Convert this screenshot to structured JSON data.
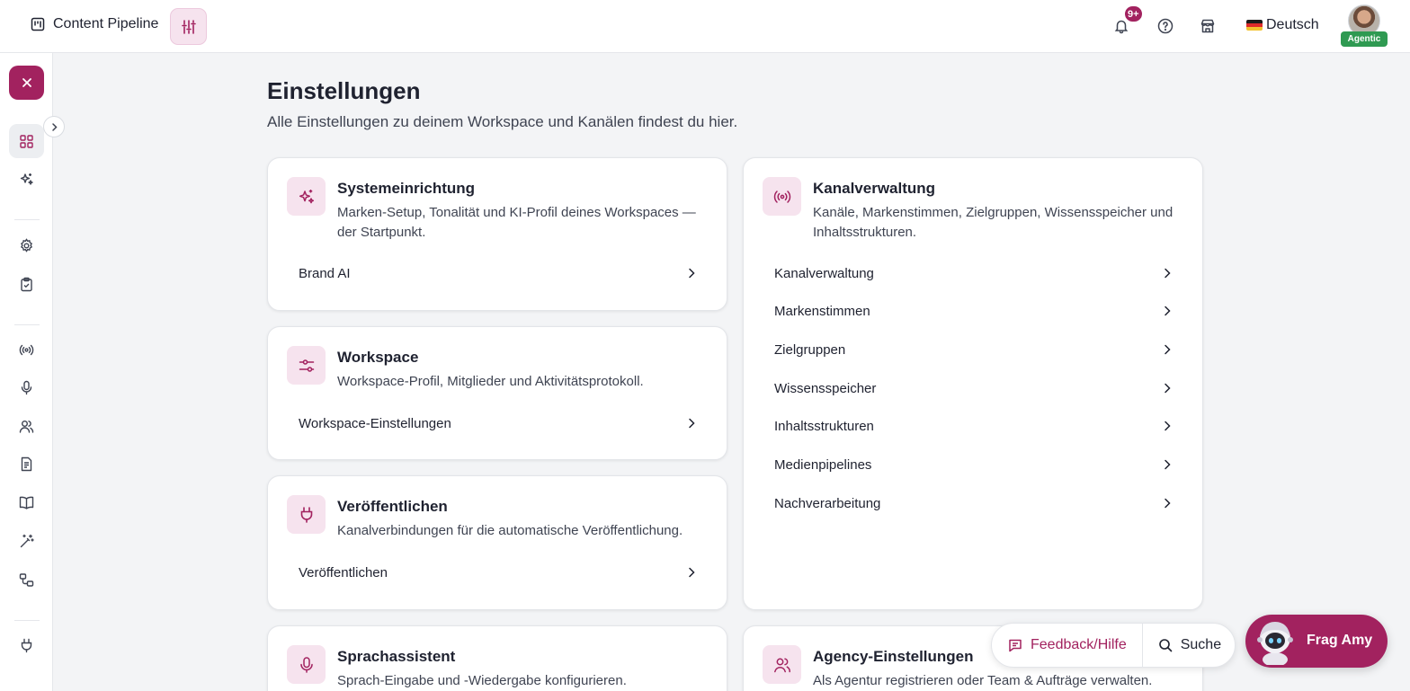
{
  "header": {
    "app_title": "Content Pipeline",
    "notification_badge": "9+",
    "language": "Deutsch",
    "user_badge": "Agentic"
  },
  "sidebar": {
    "items": [
      {
        "icon": "dashboard-grid-icon",
        "active": true
      },
      {
        "icon": "sparkles-icon"
      },
      {
        "icon": "gear-icon"
      },
      {
        "icon": "clipboard-check-icon"
      },
      {
        "icon": "broadcast-icon"
      },
      {
        "icon": "microphone-icon"
      },
      {
        "icon": "users-icon"
      },
      {
        "icon": "document-icon"
      },
      {
        "icon": "book-icon"
      },
      {
        "icon": "magic-wand-icon"
      },
      {
        "icon": "workflow-icon"
      },
      {
        "icon": "plug-icon"
      }
    ]
  },
  "page": {
    "title": "Einstellungen",
    "subtitle": "Alle Einstellungen zu deinem Workspace und Kanälen findest du hier."
  },
  "cards": {
    "system": {
      "icon": "sparkles-icon",
      "title": "Systemeinrichtung",
      "description": "Marken-Setup, Tonalität und KI-Profil deines Workspaces — der Startpunkt.",
      "links": [
        "Brand AI"
      ]
    },
    "workspace": {
      "icon": "sliders-icon",
      "title": "Workspace",
      "description": "Workspace-Profil, Mitglieder und Aktivitätsprotokoll.",
      "links": [
        "Workspace-Einstellungen"
      ]
    },
    "publish": {
      "icon": "plug-icon",
      "title": "Veröffentlichen",
      "description": "Kanalverbindungen für die automatische Veröffentlichung.",
      "links": [
        "Veröffentlichen"
      ]
    },
    "channels": {
      "icon": "broadcast-icon",
      "title": "Kanalverwaltung",
      "description": "Kanäle, Markenstimmen, Zielgruppen, Wissensspeicher und Inhaltsstrukturen.",
      "links": [
        "Kanalverwaltung",
        "Markenstimmen",
        "Zielgruppen",
        "Wissensspeicher",
        "Inhaltsstrukturen",
        "Medienpipelines",
        "Nachverarbeitung"
      ]
    },
    "voice": {
      "icon": "microphone-icon",
      "title": "Sprachassistent",
      "description": "Sprach-Eingabe und -Wiedergabe konfigurieren."
    },
    "agency": {
      "icon": "users-icon",
      "title": "Agency-Einstellungen",
      "description": "Als Agentur registrieren oder Team & Aufträge verwalten."
    }
  },
  "floating": {
    "feedback_label": "Feedback/Hilfe",
    "search_label": "Suche",
    "assistant_label": "Frag Amy"
  },
  "colors": {
    "accent": "#a2225f",
    "accent_light": "#f6e3ee",
    "background": "#f3f4f6",
    "agentic_badge": "#2f9a52"
  }
}
